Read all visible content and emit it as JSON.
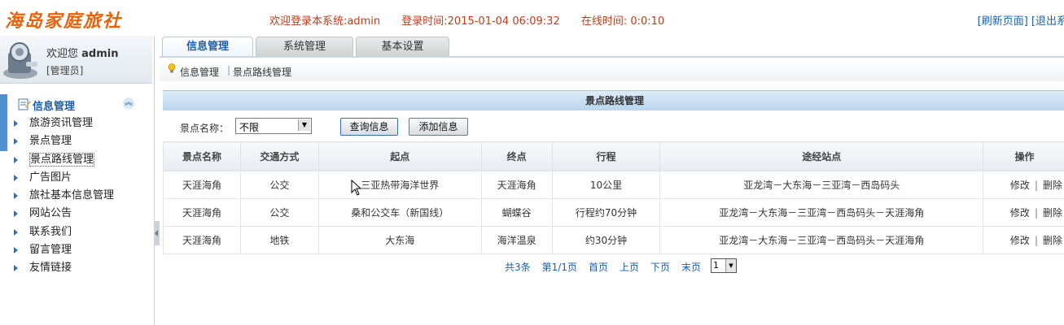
{
  "header": {
    "logo_text": "海岛家庭旅社",
    "welcome": "欢迎登录本系统:admin",
    "login_time": "登录时间:2015-01-04 06:09:32",
    "online_time": "在线时间: 0:0:10",
    "refresh_link": "[刷新页面]",
    "logout_link": "[退出系"
  },
  "user": {
    "welcome_prefix": "欢迎您",
    "name": "admin",
    "role": "[管理员]"
  },
  "sidebar": {
    "title": "信息管理",
    "items": [
      {
        "label": "旅游资讯管理"
      },
      {
        "label": "景点管理"
      },
      {
        "label": "景点路线管理"
      },
      {
        "label": "广告图片"
      },
      {
        "label": "旅社基本信息管理"
      },
      {
        "label": "网站公告"
      },
      {
        "label": "联系我们"
      },
      {
        "label": "留言管理"
      },
      {
        "label": "友情链接"
      }
    ]
  },
  "tabs": [
    {
      "label": "信息管理"
    },
    {
      "label": "系统管理"
    },
    {
      "label": "基本设置"
    }
  ],
  "breadcrumb": {
    "root": "信息管理",
    "current": "景点路线管理"
  },
  "panel": {
    "title": "景点路线管理",
    "search_label": "景点名称：",
    "search_value": "不限",
    "query_button": "查询信息",
    "add_button": "添加信息"
  },
  "table": {
    "headers": [
      "景点名称",
      "交通方式",
      "起点",
      "终点",
      "行程",
      "途经站点",
      "操作"
    ],
    "rows": [
      {
        "name": "天涯海角",
        "transport": "公交",
        "start": "三亚热带海洋世界",
        "end": "天涯海角",
        "trip": "10公里",
        "stops": "亚龙湾－大东海－三亚湾－西岛码头"
      },
      {
        "name": "天涯海角",
        "transport": "公交",
        "start": "桑和公交车（新国线）",
        "end": "蝴蝶谷",
        "trip": "行程约70分钟",
        "stops": "亚龙湾－大东海－三亚湾－西岛码头－天涯海角"
      },
      {
        "name": "天涯海角",
        "transport": "地铁",
        "start": "大东海",
        "end": "海洋温泉",
        "trip": "约30分钟",
        "stops": "亚龙湾－大东海－三亚湾－西岛码头－天涯海角"
      }
    ],
    "edit_label": "修改",
    "op_sep": "|",
    "delete_label": "删除"
  },
  "pager": {
    "total": "共3条",
    "page": "第1/1页",
    "first": "首页",
    "prev": "上页",
    "next": "下页",
    "last": "末页",
    "page_select": "1"
  }
}
